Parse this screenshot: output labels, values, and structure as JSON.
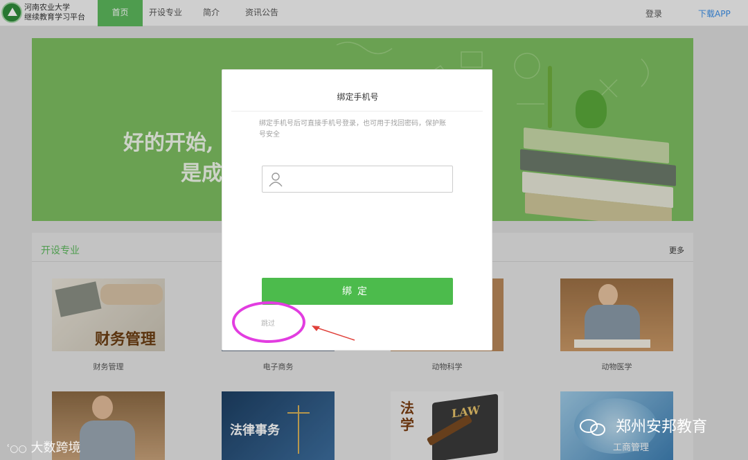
{
  "header": {
    "title_line1": "河南农业大学",
    "title_line2": "继续教育学习平台",
    "nav": [
      "首页",
      "开设专业",
      "简介",
      "资讯公告"
    ],
    "login": "登录",
    "download": "下载APP"
  },
  "banner": {
    "line1": "好的开始,",
    "line2": "是成"
  },
  "section": {
    "title": "开设专业",
    "more": "更多",
    "courses": [
      {
        "name": "财务管理",
        "thumb_label": "财务管理"
      },
      {
        "name": "电子商务",
        "thumb_label": ""
      },
      {
        "name": "动物科学",
        "thumb_label": ""
      },
      {
        "name": "动物医学",
        "thumb_label": ""
      }
    ],
    "row2_labels": [
      "",
      "法律事务",
      "法学",
      "工商管理"
    ],
    "law_book_text": "LAW"
  },
  "modal": {
    "title": "绑定手机号",
    "description": "绑定手机号后可直接手机号登录，也可用于找回密码，保护账号安全",
    "input_placeholder": "",
    "bind_label": "绑定",
    "skip_label": "跳过"
  },
  "watermarks": {
    "left": "大数跨境",
    "right": "郑州安邦教育"
  },
  "colors": {
    "accent_green": "#5cb85c",
    "button_green": "#4cbb4c",
    "highlight_magenta": "#e23de0",
    "arrow_red": "#e0403a",
    "link_blue": "#3a8ee6"
  }
}
